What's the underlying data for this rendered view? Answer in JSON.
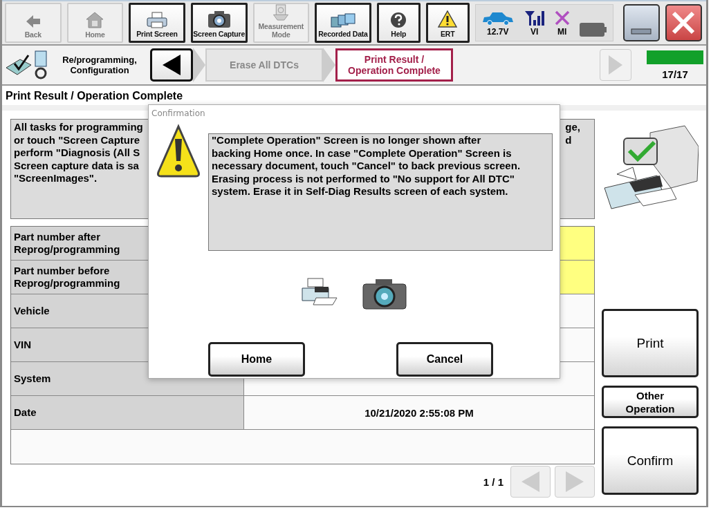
{
  "toolbar": {
    "buttons": [
      {
        "label": "Back",
        "kind": "back",
        "disabled": true
      },
      {
        "label": "Home",
        "kind": "home",
        "disabled": true
      },
      {
        "label": "Print Screen",
        "kind": "printer",
        "disabled": false
      },
      {
        "label": "Screen Capture",
        "kind": "camera",
        "disabled": false
      },
      {
        "label": "Measurement Mode",
        "kind": "meter",
        "disabled": true
      },
      {
        "label": "Recorded Data",
        "kind": "folders",
        "disabled": false
      },
      {
        "label": "Help",
        "kind": "help",
        "disabled": false
      },
      {
        "label": "ERT",
        "kind": "warning",
        "disabled": false
      }
    ],
    "status": [
      {
        "label": "12.7V",
        "kind": "car"
      },
      {
        "label": "VI",
        "kind": "signal"
      },
      {
        "label": "MI",
        "kind": "cross"
      },
      {
        "kind": "battery"
      }
    ]
  },
  "breadcrumb": {
    "section": "Re/programming, Configuration",
    "steps": [
      {
        "label": "Erase All DTCs",
        "selected": false
      },
      {
        "label": "Print Result / Operation Complete",
        "selected": true
      }
    ],
    "next_disabled": true,
    "progress": {
      "level": 1,
      "label": "17/17"
    }
  },
  "page_title": "Print Result / Operation Complete",
  "intro": {
    "left_lines": [
      "All tasks for programming",
      "or touch \"Screen Capture",
      "perform \"Diagnosis (All S",
      "Screen capture data is sa",
      "\"ScreenImages\"."
    ],
    "right_lines": [
      "ge,",
      "d"
    ]
  },
  "table": {
    "rows": [
      {
        "label": "Part number after\nReprog/programming",
        "highlighted": true
      },
      {
        "label": "Part number before\nReprog/programming",
        "highlighted": true
      },
      {
        "label": "Vehicle",
        "highlighted": false
      },
      {
        "label": "VIN",
        "highlighted": false
      },
      {
        "label": "System",
        "highlighted": false
      },
      {
        "label": "Date",
        "value": "10/21/2020 2:55:08 PM",
        "highlighted": false
      }
    ]
  },
  "pager": {
    "label": "1 / 1",
    "prev_disabled": true,
    "next_disabled": true
  },
  "side_buttons": [
    {
      "label": "Print",
      "kind": "large"
    },
    {
      "label": "Other Operation",
      "kind": "small"
    },
    {
      "label": "Confirm",
      "kind": "large"
    }
  ],
  "dialog": {
    "title": "Confirmation",
    "message": "\"Complete Operation\" Screen is no longer shown after\nbacking Home once. In case \"Complete Operation\" Screen is\nnecessary document, touch \"Cancel\" to back previous screen.\nErasing process is not performed to \"No support for All DTC\"\nsystem. Erase it in Self-Diag Results screen of each system.",
    "buttons": [
      "Home",
      "Cancel"
    ]
  }
}
